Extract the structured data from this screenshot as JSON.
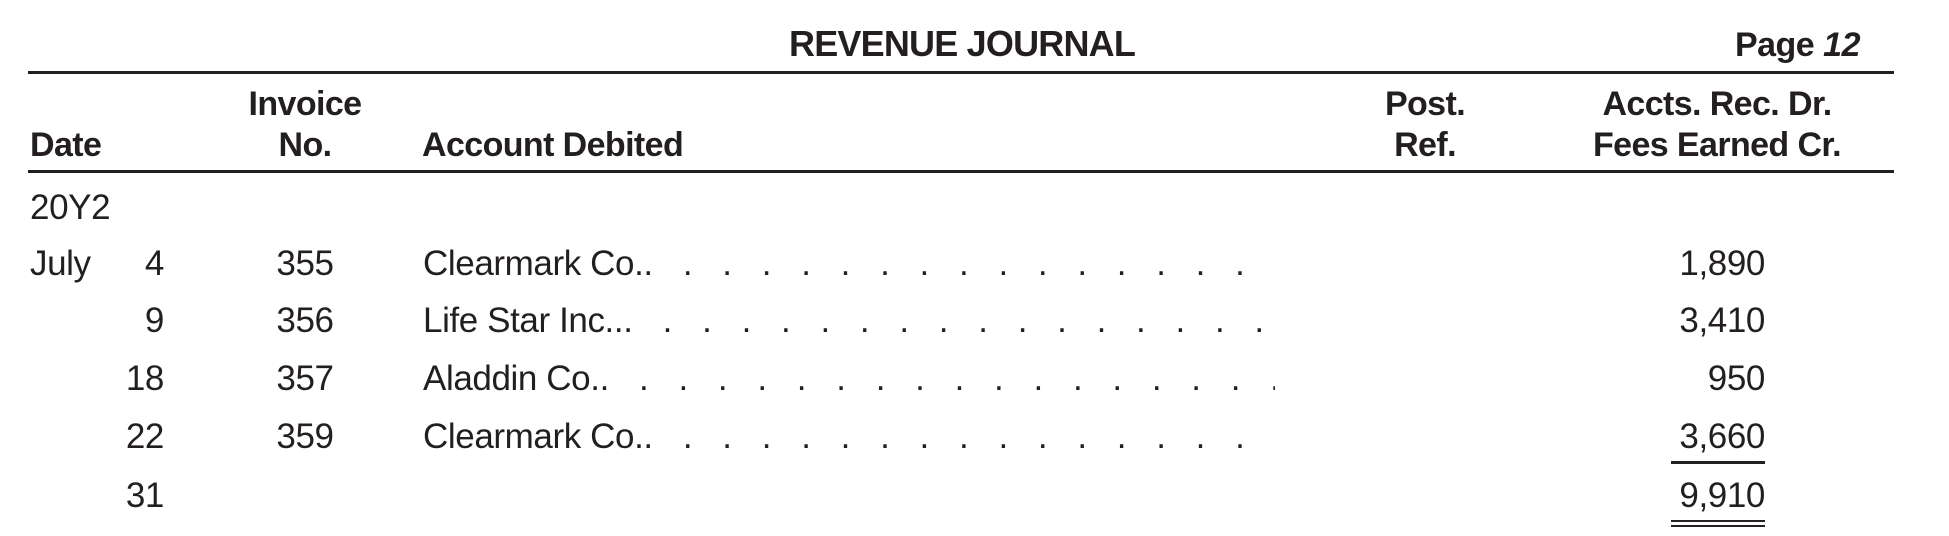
{
  "journal": {
    "title": "REVENUE JOURNAL",
    "page_label": "Page",
    "page_number": "12"
  },
  "columns": {
    "date": "Date",
    "invoice_line1": "Invoice",
    "invoice_line2": "No.",
    "account": "Account Debited",
    "post_ref_line1": "Post.",
    "post_ref_line2": "Ref.",
    "amount_line1": "Accts. Rec. Dr.",
    "amount_line2": "Fees Earned Cr."
  },
  "year_label": "20Y2",
  "rows": [
    {
      "month": "July",
      "day": "4",
      "invoice": "355",
      "account": "Clearmark Co.",
      "post_ref": "",
      "amount": "1,890"
    },
    {
      "month": "",
      "day": "9",
      "invoice": "356",
      "account": "Life Star Inc..",
      "post_ref": "",
      "amount": "3,410"
    },
    {
      "month": "",
      "day": "18",
      "invoice": "357",
      "account": "Aladdin Co.",
      "post_ref": "",
      "amount": "950"
    },
    {
      "month": "",
      "day": "22",
      "invoice": "359",
      "account": "Clearmark Co.",
      "post_ref": "",
      "amount": "3,660"
    }
  ],
  "total": {
    "day": "31",
    "amount": "9,910"
  },
  "leader": ". . . . . . . . . . . . . . . . . . . . . . . . . . . . . . . . . . . . . . . . . . . ."
}
